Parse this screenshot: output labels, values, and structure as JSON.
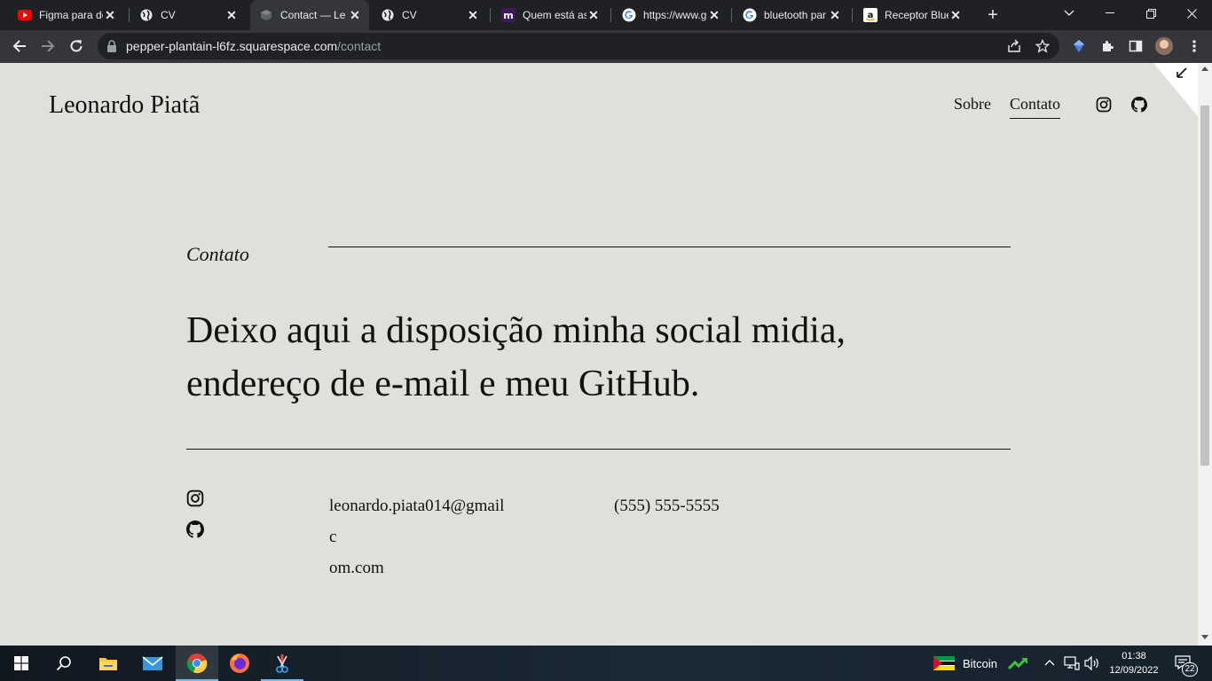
{
  "browser": {
    "tabs": [
      {
        "title": "Figma para de",
        "favicon": "youtube-icon",
        "active": false
      },
      {
        "title": "CV",
        "favicon": "globe-icon",
        "active": false
      },
      {
        "title": "Contact — Le",
        "favicon": "squarespace-icon",
        "active": true
      },
      {
        "title": "CV",
        "favicon": "globe-icon",
        "active": false
      },
      {
        "title": "Quem está as",
        "favicon": "m-icon",
        "active": false
      },
      {
        "title": "https://www.g",
        "favicon": "google-icon",
        "active": false
      },
      {
        "title": "bluetooth par",
        "favicon": "google-icon",
        "active": false
      },
      {
        "title": "Receptor Blue",
        "favicon": "amazon-icon",
        "active": false
      }
    ],
    "url_host": "pepper-plantain-l6fz.squarespace.com",
    "url_path": "/contact"
  },
  "site": {
    "title": "Leonardo Piatã",
    "nav": [
      {
        "label": "Sobre",
        "current": false
      },
      {
        "label": "Contato",
        "current": true
      }
    ]
  },
  "contact": {
    "section_label": "Contato",
    "headline": "Deixo aqui a disposição minha social midia, endereço de e-mail e meu GitHub.",
    "email": "leonardo.piata014@gmailcom.com",
    "email_line1": "leonardo.piata014@gmailc",
    "email_line2": "om.com",
    "phone": "(555) 555-5555",
    "social_icons": [
      "instagram-icon",
      "github-icon"
    ]
  },
  "taskbar": {
    "tray_label": "Bitcoin",
    "time": "01:38",
    "date": "12/09/2022",
    "notification_count": "22"
  },
  "colors": {
    "page_bg": "#e0e0db",
    "text": "#111111",
    "browser_dark": "#202124",
    "toolbar": "#35363a"
  }
}
